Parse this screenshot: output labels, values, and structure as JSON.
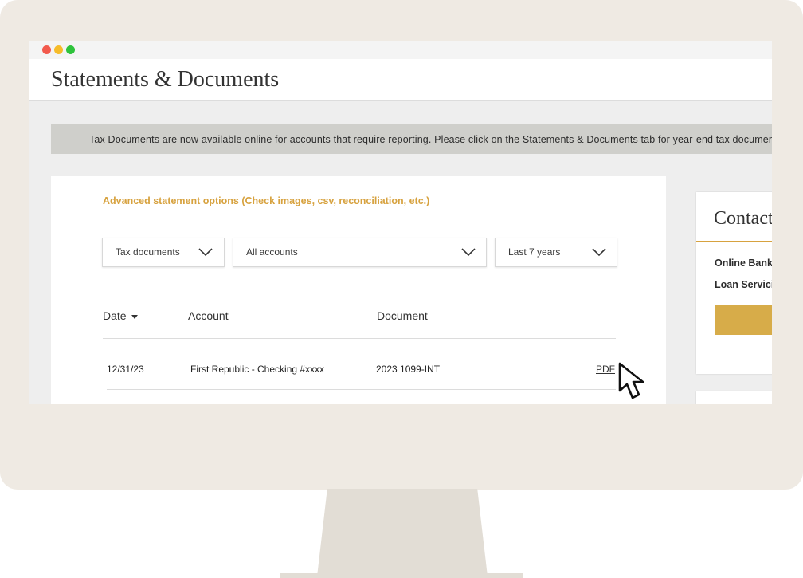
{
  "page": {
    "title": "Statements & Documents",
    "banner_text": "Tax Documents are now available online for accounts that require reporting. Please click on the Statements & Documents tab for year-end tax documents."
  },
  "statements": {
    "advanced_link": "Advanced statement options (Check images, csv, reconciliation, etc.)",
    "filters": {
      "document_type": "Tax documents",
      "account": "All accounts",
      "period": "Last 7 years"
    },
    "columns": {
      "date": "Date",
      "account": "Account",
      "document": "Document"
    },
    "rows": [
      {
        "date": "12/31/23",
        "account": "First Republic - Checking #xxxx",
        "document": "2023 1099-INT",
        "link": "PDF"
      }
    ]
  },
  "contact": {
    "title": "Contact",
    "lines": [
      "Online Banking",
      "Loan Servicing"
    ]
  },
  "colors": {
    "accent_gold": "#d7a23f",
    "banner_gray": "#cfcfcb",
    "monitor_frame": "#efeae3"
  },
  "icons": {
    "window_controls": [
      "close-dot",
      "minimize-dot",
      "maximize-dot"
    ],
    "dropdown": "chevron-down-icon",
    "sort": "sort-desc-icon",
    "pointer": "mouse-cursor-icon"
  }
}
